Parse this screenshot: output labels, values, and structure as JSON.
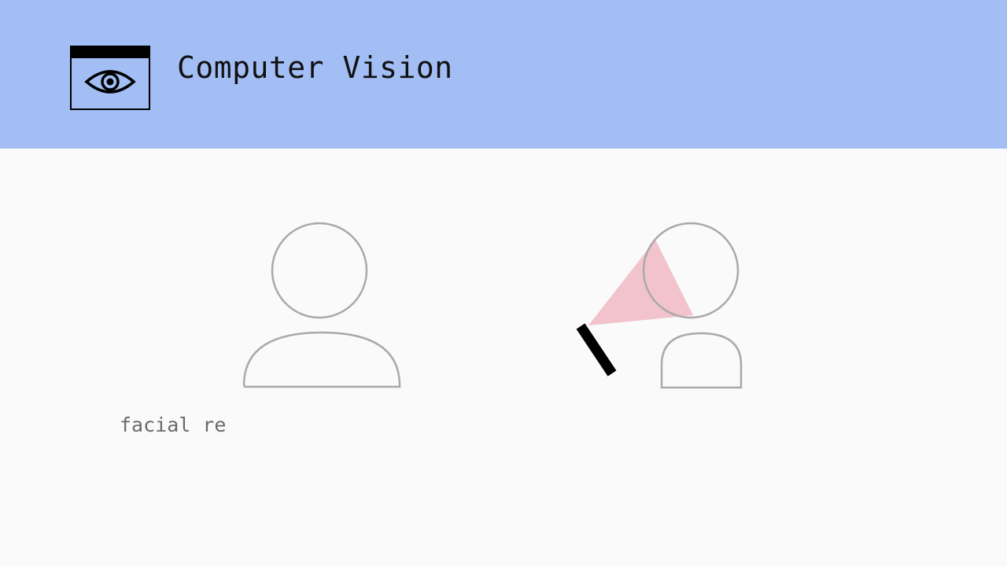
{
  "header": {
    "title": "Computer Vision",
    "background_color": "#a2bef5",
    "icon": "eye-icon"
  },
  "scene": {
    "person_left_icon": "person-icon",
    "person_right_icon": "person-icon",
    "camera_icon": "camera-icon",
    "beam_color": "#f0b9c3",
    "outline_color": "#a9a9a9"
  },
  "caption": {
    "text": "facial re"
  }
}
